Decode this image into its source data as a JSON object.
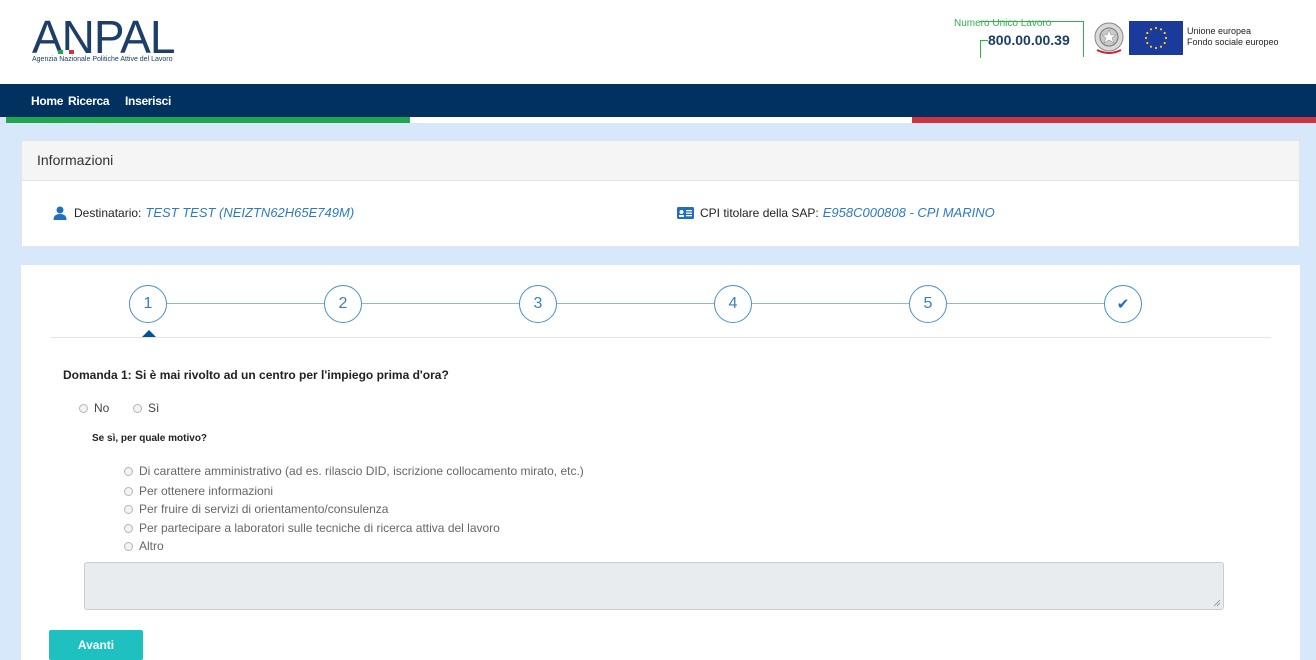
{
  "header": {
    "logo_text": "ANPAL",
    "logo_subtitle": "Agenzia Nazionale Politiche Attive del Lavoro",
    "number_label": "Numero Unico Lavoro",
    "number_value": "800.00.00.39",
    "eu_line1": "Unione europea",
    "eu_line2": "Fondo sociale europeo"
  },
  "nav": {
    "items": [
      "Home",
      "Ricerca",
      "Inserisci"
    ]
  },
  "info": {
    "title": "Informazioni",
    "recipient_label": "Destinatario:",
    "recipient_value": "TEST TEST (NEIZTN62H65E749M)",
    "cpi_label": "CPI titolare della SAP:",
    "cpi_value": "E958C000808 - CPI MARINO"
  },
  "stepper": {
    "steps": [
      "1",
      "2",
      "3",
      "4",
      "5",
      "✔"
    ],
    "current": 1
  },
  "form": {
    "question": "Domanda 1: Si è mai rivolto ad un centro per l'impiego prima d'ora?",
    "answers": [
      "No",
      "Sì"
    ],
    "sub_question": "Se sì, per quale motivo?",
    "reasons": [
      "Di carattere amministrativo (ad es. rilascio DID, iscrizione collocamento mirato, etc.)",
      "Per ottenere informazioni",
      "Per fruire di servizi di orientamento/consulenza",
      "Per partecipare a laboratori sulle tecniche di ricerca attiva del lavoro",
      "Altro"
    ],
    "other_text": "",
    "next_button": "Avanti"
  },
  "colors": {
    "navbar": "#00315f",
    "accent_link": "#2d7ac2",
    "button": "#1ec1bf",
    "italy_green": "#21a54f",
    "italy_red": "#d1323f"
  }
}
